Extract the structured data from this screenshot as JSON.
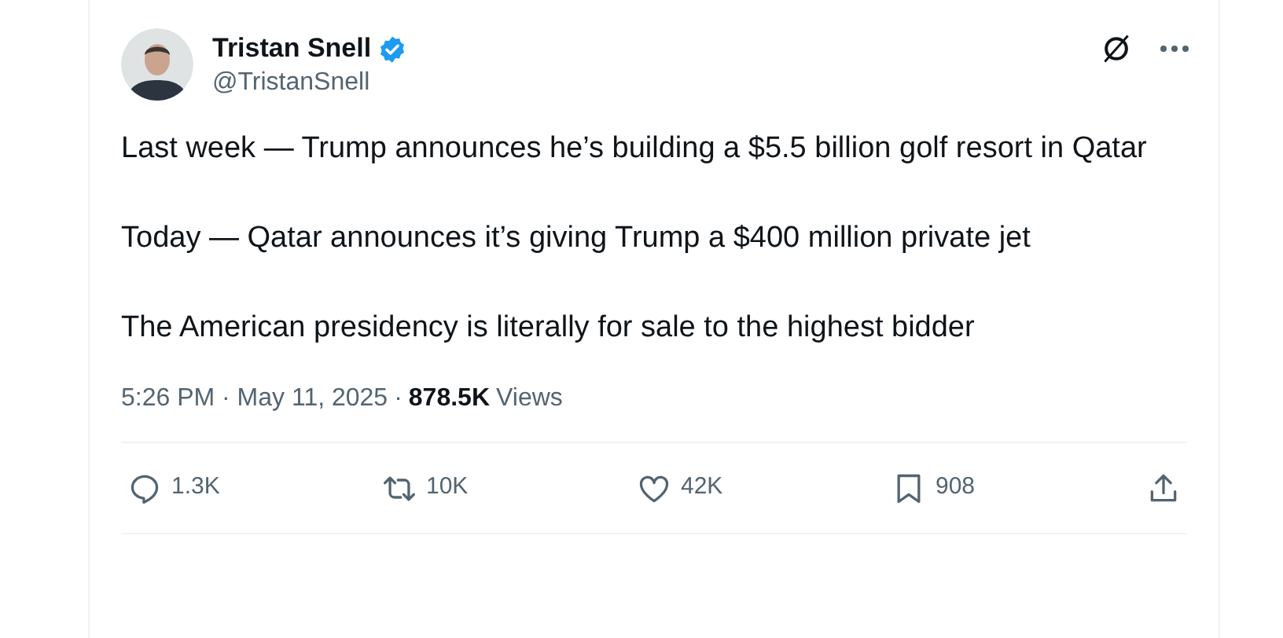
{
  "author": {
    "name": "Tristan Snell",
    "handle": "@TristanSnell",
    "verified": true
  },
  "paragraphs": [
    "Last week — Trump announces he’s building a $5.5 billion golf resort in Qatar",
    "Today — Qatar announces it’s giving Trump a $400 million private jet",
    "The American presidency is literally for sale to the highest bidder"
  ],
  "meta": {
    "time": "5:26 PM · May 11, 2025",
    "dot": "·",
    "views_count": "878.5K",
    "views_label": "Views"
  },
  "actions": [
    {
      "kind": "reply",
      "count": "1.3K"
    },
    {
      "kind": "repost",
      "count": "10K"
    },
    {
      "kind": "like",
      "count": "42K"
    },
    {
      "kind": "bookmark",
      "count": "908"
    },
    {
      "kind": "share"
    }
  ]
}
